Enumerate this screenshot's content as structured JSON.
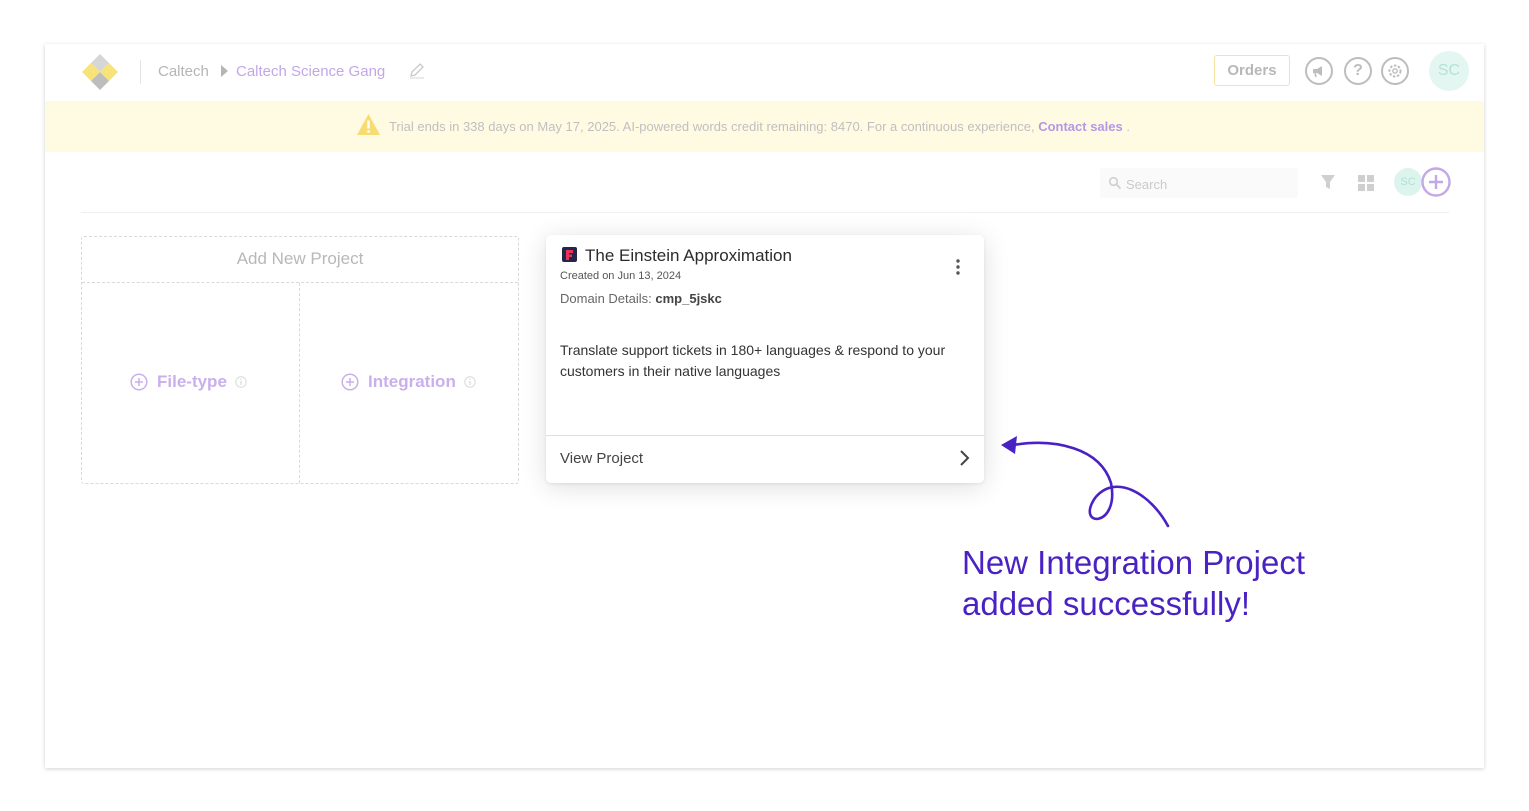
{
  "header": {
    "breadcrumb_root": "Caltech",
    "breadcrumb_current": "Caltech Science Gang",
    "orders_label": "Orders",
    "avatar_initials": "SC",
    "icons": [
      "announcement-icon",
      "help-icon",
      "settings-icon",
      "edit-icon"
    ]
  },
  "banner": {
    "text": "Trial ends in 338 days on May 17, 2025. AI-powered words credit remaining: 8470. For a continuous experience,",
    "link": "Contact sales",
    "suffix": " ."
  },
  "toolbar": {
    "search_placeholder": "Search",
    "avatar_initials": "SC"
  },
  "add_project": {
    "title": "Add New Project",
    "file_type_label": "File-type",
    "integration_label": "Integration"
  },
  "project": {
    "title": "The Einstein Approximation",
    "created": "Created on Jun 13, 2024",
    "domain_label": "Domain Details: ",
    "domain_value": "cmp_5jskc",
    "description": "Translate support tickets in 180+ languages & respond to your customers in their native languages",
    "view_label": "View Project"
  },
  "annotation": {
    "line1": "New Integration Project",
    "line2": "added successfully!"
  },
  "colors": {
    "accent": "#c3a7e6",
    "annotation": "#4a22c4",
    "banner_bg": "#fffbe3",
    "avatar_bg": "#e3f6f1"
  }
}
